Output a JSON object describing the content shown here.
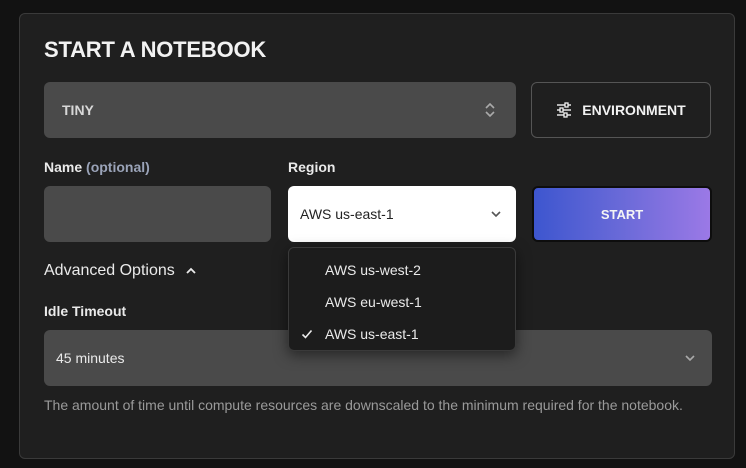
{
  "title": "START A NOTEBOOK",
  "instance_size": {
    "value": "TINY",
    "icon": "updown-chevron-icon"
  },
  "environment_button": {
    "label": "ENVIRONMENT",
    "icon": "sliders-icon"
  },
  "name_field": {
    "label": "Name",
    "optional_label": "(optional)",
    "value": ""
  },
  "region": {
    "label": "Region",
    "selected": "AWS us-east-1",
    "options": [
      "AWS us-west-2",
      "AWS eu-west-1",
      "AWS us-east-1"
    ],
    "checked_index": 2
  },
  "start_button": {
    "label": "START"
  },
  "advanced_options": {
    "label": "Advanced Options",
    "expanded": true
  },
  "idle_timeout": {
    "label": "Idle Timeout",
    "value": "45 minutes",
    "help": "The amount of time until compute resources are downscaled to the minimum required for the notebook."
  },
  "colors": {
    "background": "#121212",
    "panel": "#1f1f1f",
    "field": "#4a4a4a",
    "accent_gradient_start": "#3d56cf",
    "accent_gradient_end": "#9b79e6",
    "optional_text": "#9aa3b8"
  }
}
